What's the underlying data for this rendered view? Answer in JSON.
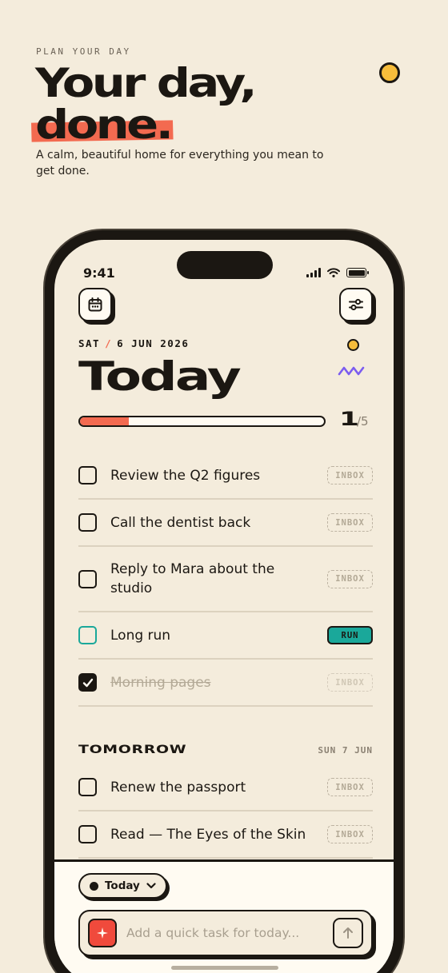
{
  "promo": {
    "eyebrow": "PLAN YOUR DAY",
    "title_line1": "Your day,",
    "title_line2": "done.",
    "subtitle": "A calm, beautiful home for everything you mean to get done."
  },
  "status_bar": {
    "time": "9:41"
  },
  "header": {
    "weekday": "SAT",
    "separator": "/",
    "date": "6 JUN 2026",
    "title": "Today"
  },
  "progress": {
    "completed": "1",
    "total": "/5",
    "fraction": 0.2,
    "fill_color": "#f36a50"
  },
  "today_tasks": [
    {
      "text": "Review the Q2 figures",
      "tag": "INBOX",
      "done": false
    },
    {
      "text": "Call the dentist back",
      "tag": "INBOX",
      "done": false
    },
    {
      "text": "Reply to Mara about the studio",
      "tag": "INBOX",
      "done": false
    },
    {
      "text": "Long run",
      "tag": "RUN",
      "done": false,
      "accent": "#1aa89a"
    },
    {
      "text": "Morning pages",
      "tag": "INBOX",
      "done": true
    }
  ],
  "tomorrow": {
    "title": "TOMORROW",
    "date": "SUN 7 JUN",
    "tasks": [
      {
        "text": "Renew the passport",
        "tag": "INBOX",
        "done": false
      },
      {
        "text": "Read — The Eyes of the Skin",
        "tag": "INBOX",
        "done": false
      }
    ]
  },
  "bottom": {
    "scope_label": "Today",
    "composer_placeholder": "Add a quick task for today..."
  },
  "colors": {
    "background": "#f4ecdc",
    "ink": "#1b1712",
    "coral": "#f36a50",
    "teal": "#1aa89a",
    "yellow": "#f7bd3b",
    "purple": "#7b5cf0"
  },
  "icons": [
    "calendar-icon",
    "sliders-icon",
    "sparkle-icon",
    "arrow-up-icon",
    "chevron-down-icon",
    "checkmark-icon",
    "signal-icon",
    "wifi-icon",
    "battery-icon",
    "squiggle-icon"
  ]
}
